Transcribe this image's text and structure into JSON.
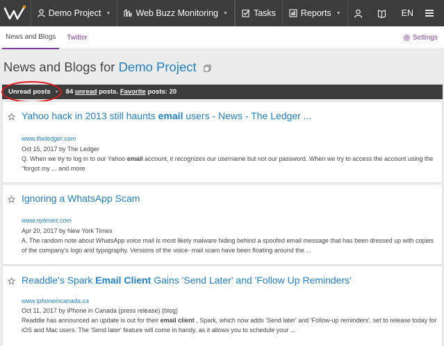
{
  "topbar": {
    "project_label": "Demo Project",
    "module_label": "Web Buzz Monitoring",
    "tasks_label": "Tasks",
    "reports_label": "Reports",
    "language": "EN"
  },
  "subnav": {
    "tabs": [
      {
        "label": "News and Blogs",
        "active": true
      },
      {
        "label": "Twitter",
        "active": false
      }
    ],
    "settings_label": "Settings"
  },
  "page": {
    "title_prefix": "News and Blogs for",
    "project_name": "Demo Project"
  },
  "filter": {
    "dropdown_label": "Unread posts",
    "unread_count": "84",
    "unread_word": "unread",
    "posts_text": "posts.",
    "favorite_word": "Favorite",
    "favorite_text": "posts: 20"
  },
  "posts": [
    {
      "title_a": "Yahoo hack in 2013 still haunts ",
      "title_b": "email",
      "title_c": " users - News - The Ledger ...",
      "source": "www.theledger.com",
      "meta": "Oct 15, 2017 by The Ledger",
      "snippet_a": "Q. When we try to log in to our Yahoo ",
      "snippet_b": "email",
      "snippet_c": " account, it recognizes our username but not our password. When we try to access the account using the \"forgot my ... and more"
    },
    {
      "title_a": "Ignoring a WhatsApp Scam",
      "title_b": "",
      "title_c": "",
      "source": "www.nytimes.com",
      "meta": "Apr 20, 2017 by New York Times",
      "snippet_a": "A. The random note about WhatsApp voice mail is most likely malware hiding behind a spoofed email message that has been dressed up with copies of the company's logo and typography. Versions of the voice- mail scam have been floating around the ...",
      "snippet_b": "",
      "snippet_c": ""
    },
    {
      "title_a": "Readdle's Spark ",
      "title_b": "Email Client",
      "title_c": " Gains 'Send Later' and 'Follow Up Reminders'",
      "source": "www.iphoneincanada.ca",
      "meta": "Oct 11, 2017 by iPhone in Canada (press release) (blog)",
      "snippet_a": "Readdle has announced an update is out for their ",
      "snippet_b": "email client",
      "snippet_c": " , Spark, which now adds 'Send later' and 'Follow-up reminders', set to release today for iOS and Mac users. The 'Send later' feature will come in handy, as it allows you to schedule your ..."
    }
  ],
  "colors": {
    "accent": "#7b3a98",
    "link": "#1e7fc4",
    "topbar": "#3c3c3c",
    "highlight_oval": "#e0181d"
  }
}
